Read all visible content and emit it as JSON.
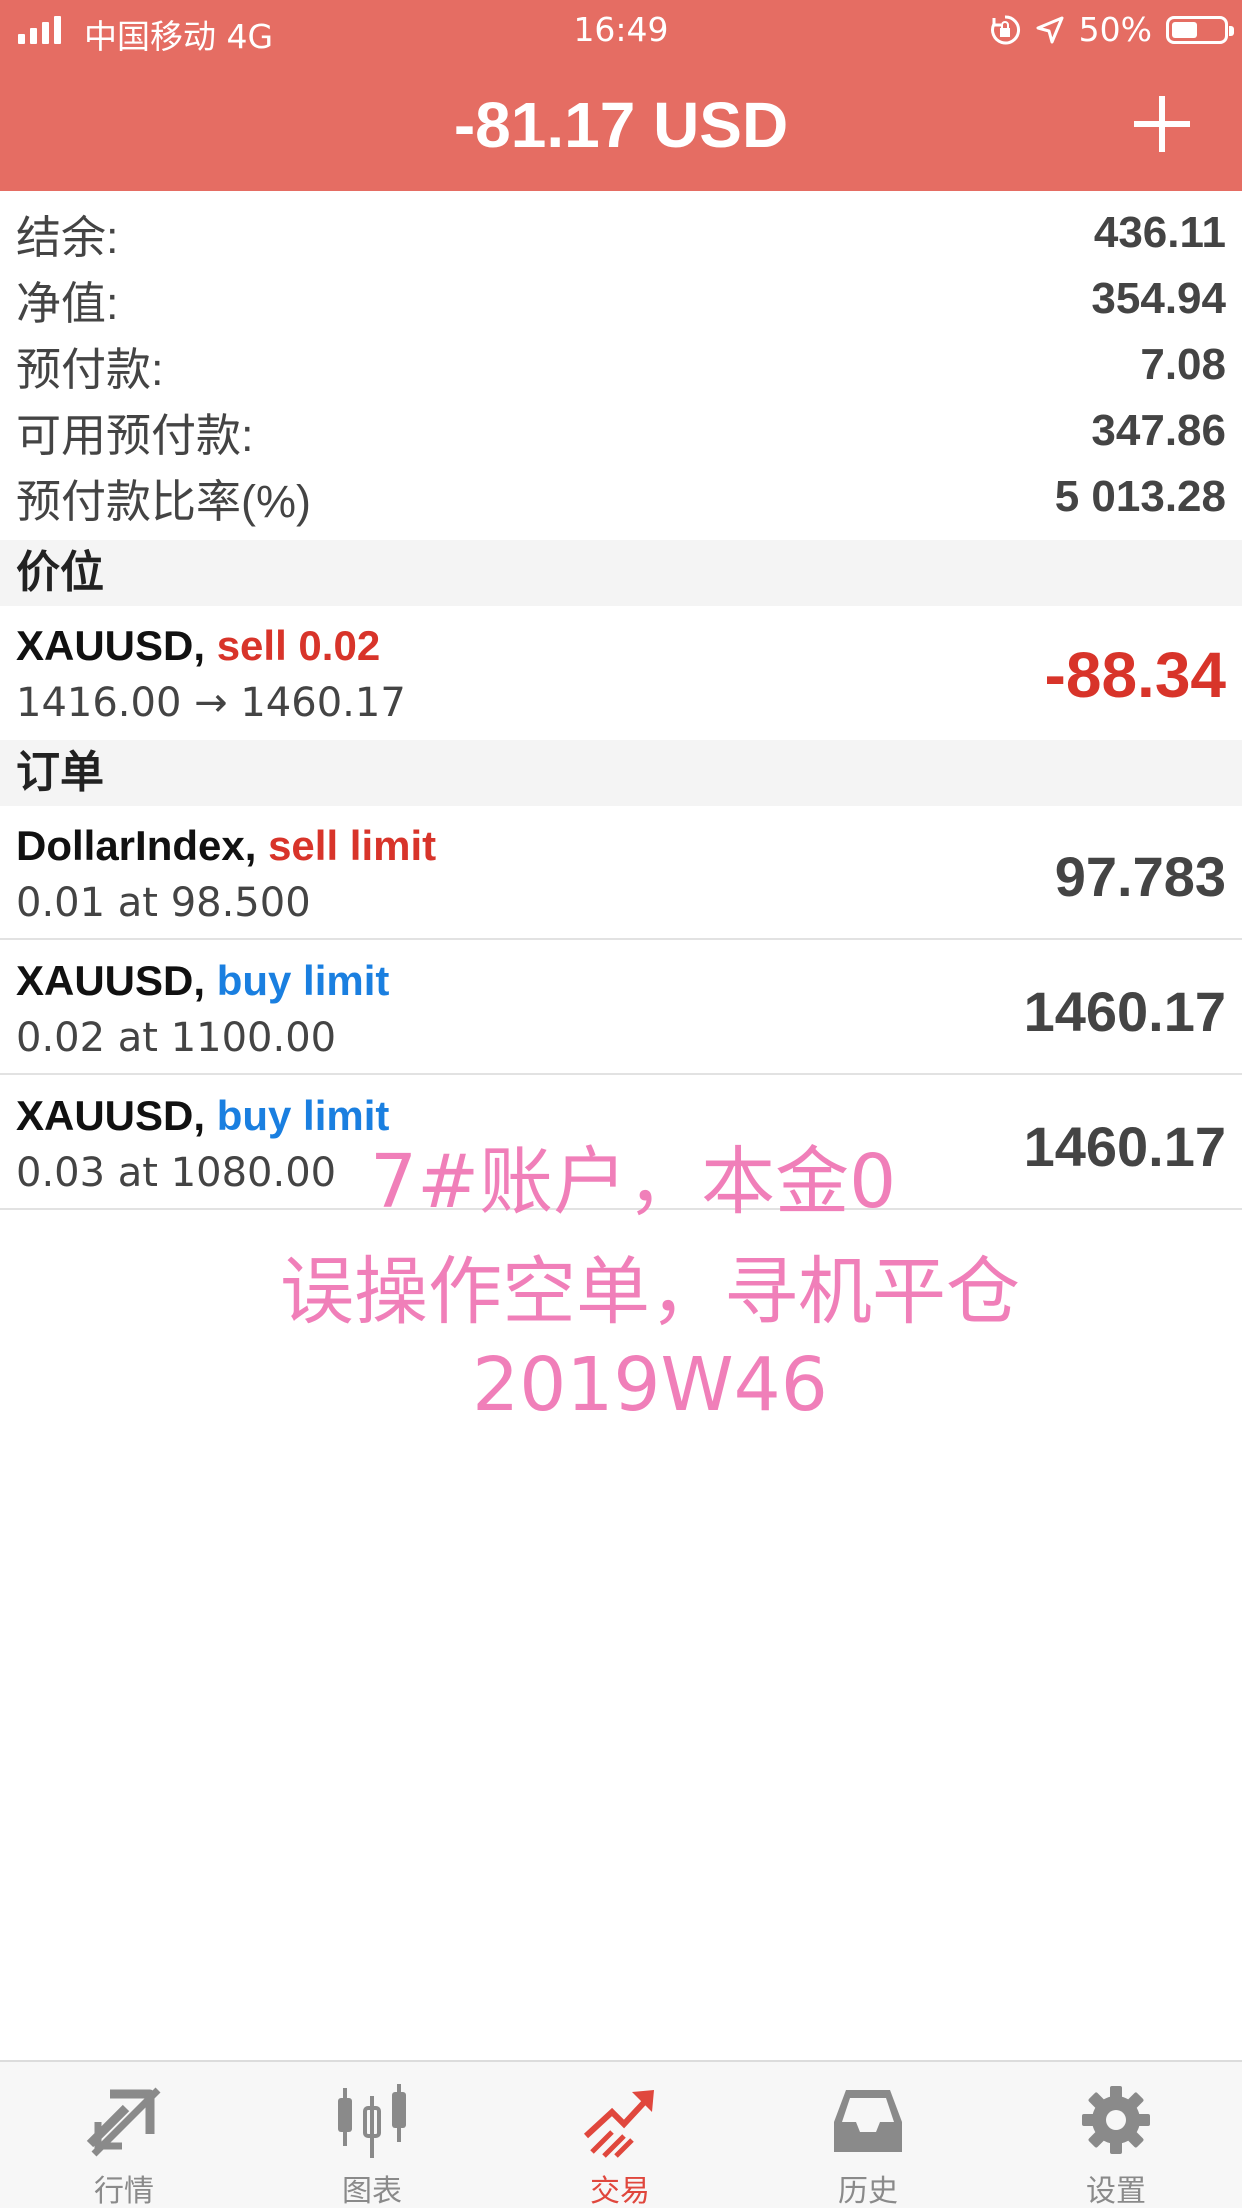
{
  "status_bar": {
    "carrier": "中国移动 4G",
    "time": "16:49",
    "battery": "50%",
    "battery_level": 0.5
  },
  "header": {
    "title": "-81.17 USD"
  },
  "summary": [
    {
      "label": "结余:",
      "value": "436.11"
    },
    {
      "label": "净值:",
      "value": "354.94"
    },
    {
      "label": "预付款:",
      "value": "7.08"
    },
    {
      "label": "可用预付款:",
      "value": "347.86"
    },
    {
      "label": "预付款比率(%)",
      "value": "5 013.28"
    }
  ],
  "positions": {
    "header": "价位",
    "items": [
      {
        "symbol": "XAUUSD,",
        "side": "sell 0.02",
        "detail": "1416.00 → 1460.17",
        "profit": "-88.34"
      }
    ]
  },
  "orders": {
    "header": "订单",
    "items": [
      {
        "symbol": "DollarIndex,",
        "type": "sell limit",
        "detail": "0.01 at 98.500",
        "price": "97.783"
      },
      {
        "symbol": "XAUUSD,",
        "type": "buy limit",
        "detail": "0.02 at 1100.00",
        "price": "1460.17"
      },
      {
        "symbol": "XAUUSD,",
        "type": "buy limit",
        "detail": "0.03 at 1080.00",
        "price": "1460.17"
      }
    ]
  },
  "overlay_text": [
    "7#账户，本金0",
    "误操作空单，寻机平仓",
    "2019W46"
  ],
  "tabs": [
    {
      "label": "行情",
      "icon": "quotes-icon"
    },
    {
      "label": "图表",
      "icon": "chart-icon"
    },
    {
      "label": "交易",
      "icon": "trade-icon",
      "active": true
    },
    {
      "label": "历史",
      "icon": "history-icon"
    },
    {
      "label": "设置",
      "icon": "settings-icon"
    }
  ],
  "colors": {
    "header": "#e56d63",
    "sell": "#d8342a",
    "buy": "#1a7fe0",
    "overlay": "#f07fb9"
  }
}
